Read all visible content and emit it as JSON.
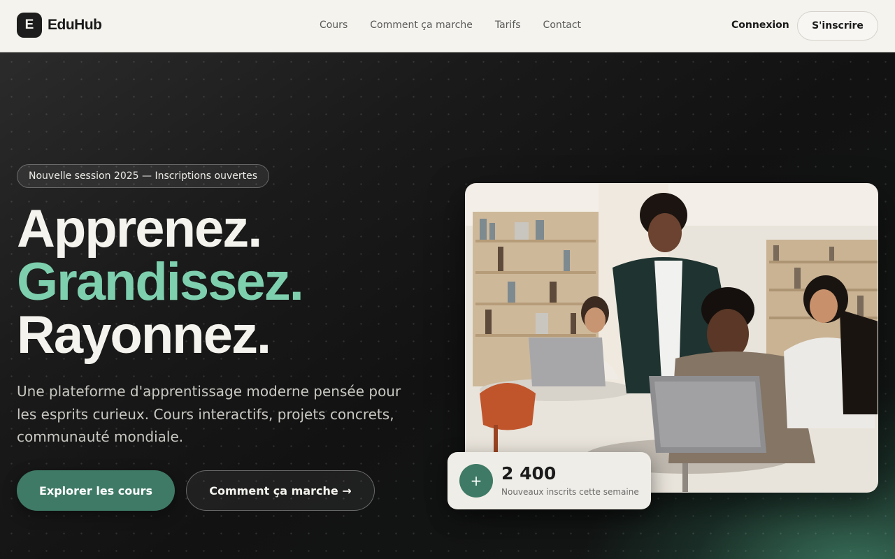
{
  "brand": {
    "logo_letter": "E",
    "name": "EduHub"
  },
  "nav": {
    "links": [
      "Cours",
      "Comment ça marche",
      "Tarifs",
      "Contact"
    ],
    "login_label": "Connexion",
    "signup_label": "S'inscrire"
  },
  "hero": {
    "badge": "Nouvelle session 2025 — Inscriptions ouvertes",
    "headline": [
      "Apprenez.",
      "Grandissez.",
      "Rayonnez."
    ],
    "subtitle": "Une plateforme d'apprentissage moderne pensée pour les esprits curieux. Cours interactifs, projets concrets, communauté mondiale.",
    "primary_cta": "Explorer les cours",
    "secondary_cta": "Comment ça marche →"
  },
  "stats_card": {
    "icon": "plus-icon",
    "icon_glyph": "+",
    "value": "2 400",
    "label": "Nouveaux inscrits cette semaine"
  },
  "colors": {
    "accent": "#7dcfae",
    "primary_button": "#3e7a66",
    "nav_background": "#f4f3ee",
    "hero_background": "#141414"
  }
}
